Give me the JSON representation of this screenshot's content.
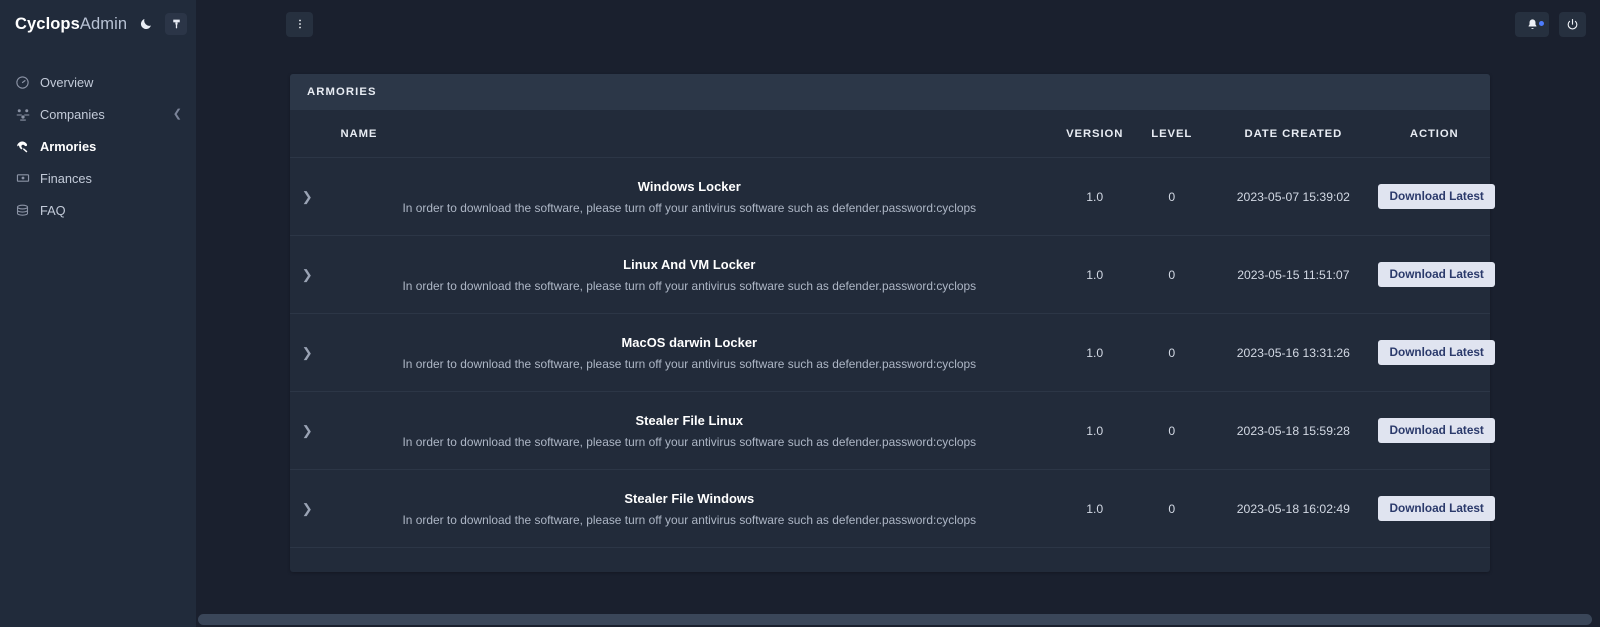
{
  "brand": {
    "name_bold": "Cyclops",
    "name_light": "Admin",
    "theme_toggle_icon": "moon-icon",
    "palette_icon": "paint-brush-icon"
  },
  "sidebar": {
    "items": [
      {
        "label": "Overview",
        "icon": "gauge-icon",
        "active": false,
        "expandable": false
      },
      {
        "label": "Companies",
        "icon": "users-icon",
        "active": false,
        "expandable": true
      },
      {
        "label": "Armories",
        "icon": "shield-icon",
        "active": true,
        "expandable": false
      },
      {
        "label": "Finances",
        "icon": "banknote-icon",
        "active": false,
        "expandable": false
      },
      {
        "label": "FAQ",
        "icon": "database-icon",
        "active": false,
        "expandable": false
      }
    ]
  },
  "topbar": {
    "menu_icon": "vertical-dots-icon",
    "notifications_icon": "bell-icon",
    "notifications_badge": true,
    "power_icon": "power-icon"
  },
  "card": {
    "title": "ARMORIES",
    "columns": {
      "name": "NAME",
      "version": "VERSION",
      "level": "LEVEL",
      "date_created": "DATE CREATED",
      "action": "ACTION"
    },
    "rows": [
      {
        "name": "Windows Locker",
        "description": "In order to download the software, please turn off your antivirus software such as defender.password:cyclops",
        "version": "1.0",
        "level": "0",
        "date_created": "2023-05-07 15:39:02",
        "action_label": "Download Latest",
        "expand_icon": "chevron-right-icon"
      },
      {
        "name": "Linux And VM Locker",
        "description": "In order to download the software, please turn off your antivirus software such as defender.password:cyclops",
        "version": "1.0",
        "level": "0",
        "date_created": "2023-05-15 11:51:07",
        "action_label": "Download Latest",
        "expand_icon": "chevron-right-icon"
      },
      {
        "name": "MacOS darwin Locker",
        "description": "In order to download the software, please turn off your antivirus software such as defender.password:cyclops",
        "version": "1.0",
        "level": "0",
        "date_created": "2023-05-16 13:31:26",
        "action_label": "Download Latest",
        "expand_icon": "chevron-right-icon"
      },
      {
        "name": "Stealer File Linux",
        "description": "In order to download the software, please turn off your antivirus software such as defender.password:cyclops",
        "version": "1.0",
        "level": "0",
        "date_created": "2023-05-18 15:59:28",
        "action_label": "Download Latest",
        "expand_icon": "chevron-right-icon"
      },
      {
        "name": "Stealer File Windows",
        "description": "In order to download the software, please turn off your antivirus software such as defender.password:cyclops",
        "version": "1.0",
        "level": "0",
        "date_created": "2023-05-18 16:02:49",
        "action_label": "Download Latest",
        "expand_icon": "chevron-right-icon"
      }
    ]
  },
  "colors": {
    "app_background": "#1a202e",
    "sidebar_background": "#212b3b",
    "card_background": "#222b3a",
    "card_header_background": "#2c3748",
    "row_divider": "#2c3646",
    "button_background": "#e0e4f0",
    "button_text": "#2b3a6b",
    "badge_dot": "#4d7cfe",
    "scrollbar_thumb": "#3a4659"
  }
}
